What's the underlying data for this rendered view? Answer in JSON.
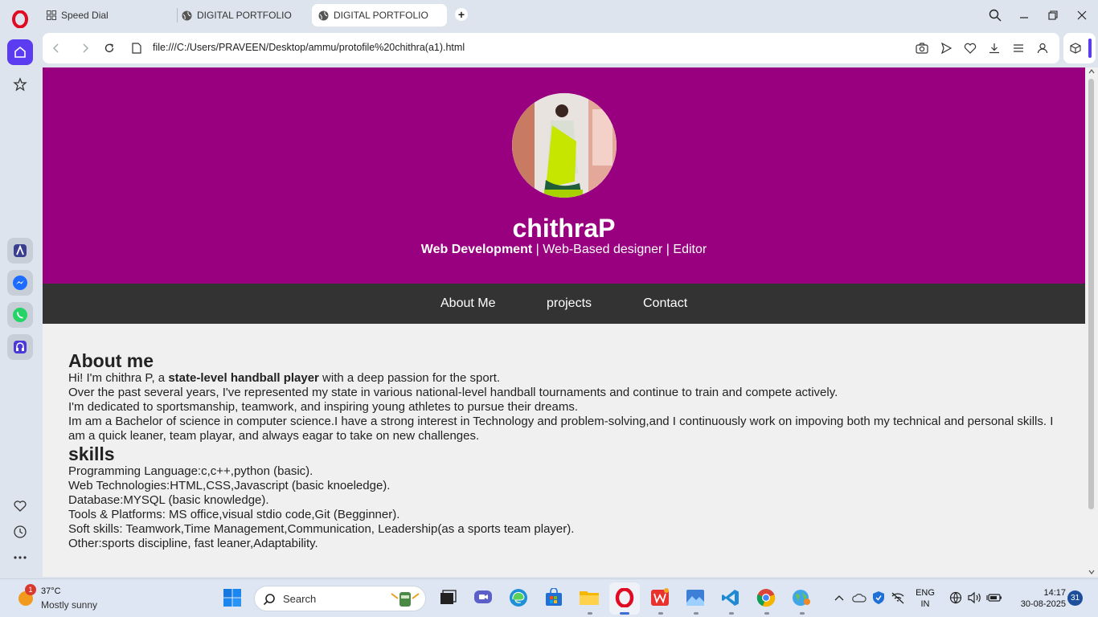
{
  "browser": {
    "tabs": [
      {
        "label": "Speed Dial"
      },
      {
        "label": "DIGITAL PORTFOLIO"
      },
      {
        "label": "DIGITAL PORTFOLIO"
      }
    ],
    "url": "file:///C:/Users/PRAVEEN/Desktop/ammu/protofile%20chithra(a1).html"
  },
  "page": {
    "name": "chithraP",
    "subtitle": {
      "highlight": "Web Development",
      "rest": " | Web-Based designer | Editor"
    },
    "nav": [
      "About Me",
      "projects",
      "Contact"
    ],
    "about": {
      "heading": "About me",
      "line1_pre": "Hi! I'm chithra P, a ",
      "line1_bold": "state-level handball player",
      "line1_post": " with a deep passion for the sport.",
      "line2": "Over the past several years, I've represented my state in various national-level handball tournaments and continue to train and compete actively.",
      "line3": "I'm dedicated to sportsmanship, teamwork, and inspiring young athletes to pursue their dreams.",
      "line4": "Im am a Bachelor of science in computer science.I have a strong interest in Technology and problem-solving,and I continuously work on impoving both my technical and personal skills. I am a quick leaner, team playar, and always eagar to take on new challenges."
    },
    "skills": {
      "heading": "skills",
      "items": [
        "Programming Language:c,c++,python (basic).",
        "Web Technologies:HTML,CSS,Javascript (basic knoeledge).",
        "Database:MYSQL (basic knowledge).",
        "Tools & Platforms: MS office,visual stdio code,Git (Begginner).",
        "Soft skills: Teamwork,Time Management,Communication, Leadership(as a sports team player).",
        "Other:sports discipline, fast leaner,Adaptability."
      ]
    }
  },
  "taskbar": {
    "weather_temp": "37°C",
    "weather_desc": "Mostly sunny",
    "weather_badge": "1",
    "search_placeholder": "Search",
    "lang_line1": "ENG",
    "lang_line2": "IN",
    "time": "14:17",
    "date": "30-08-2025",
    "notif_count": "31"
  },
  "colors": {
    "hero": "#990080",
    "nav": "#333333",
    "opera_red": "#e00a22",
    "sidebar_active": "#5c3cf0"
  }
}
